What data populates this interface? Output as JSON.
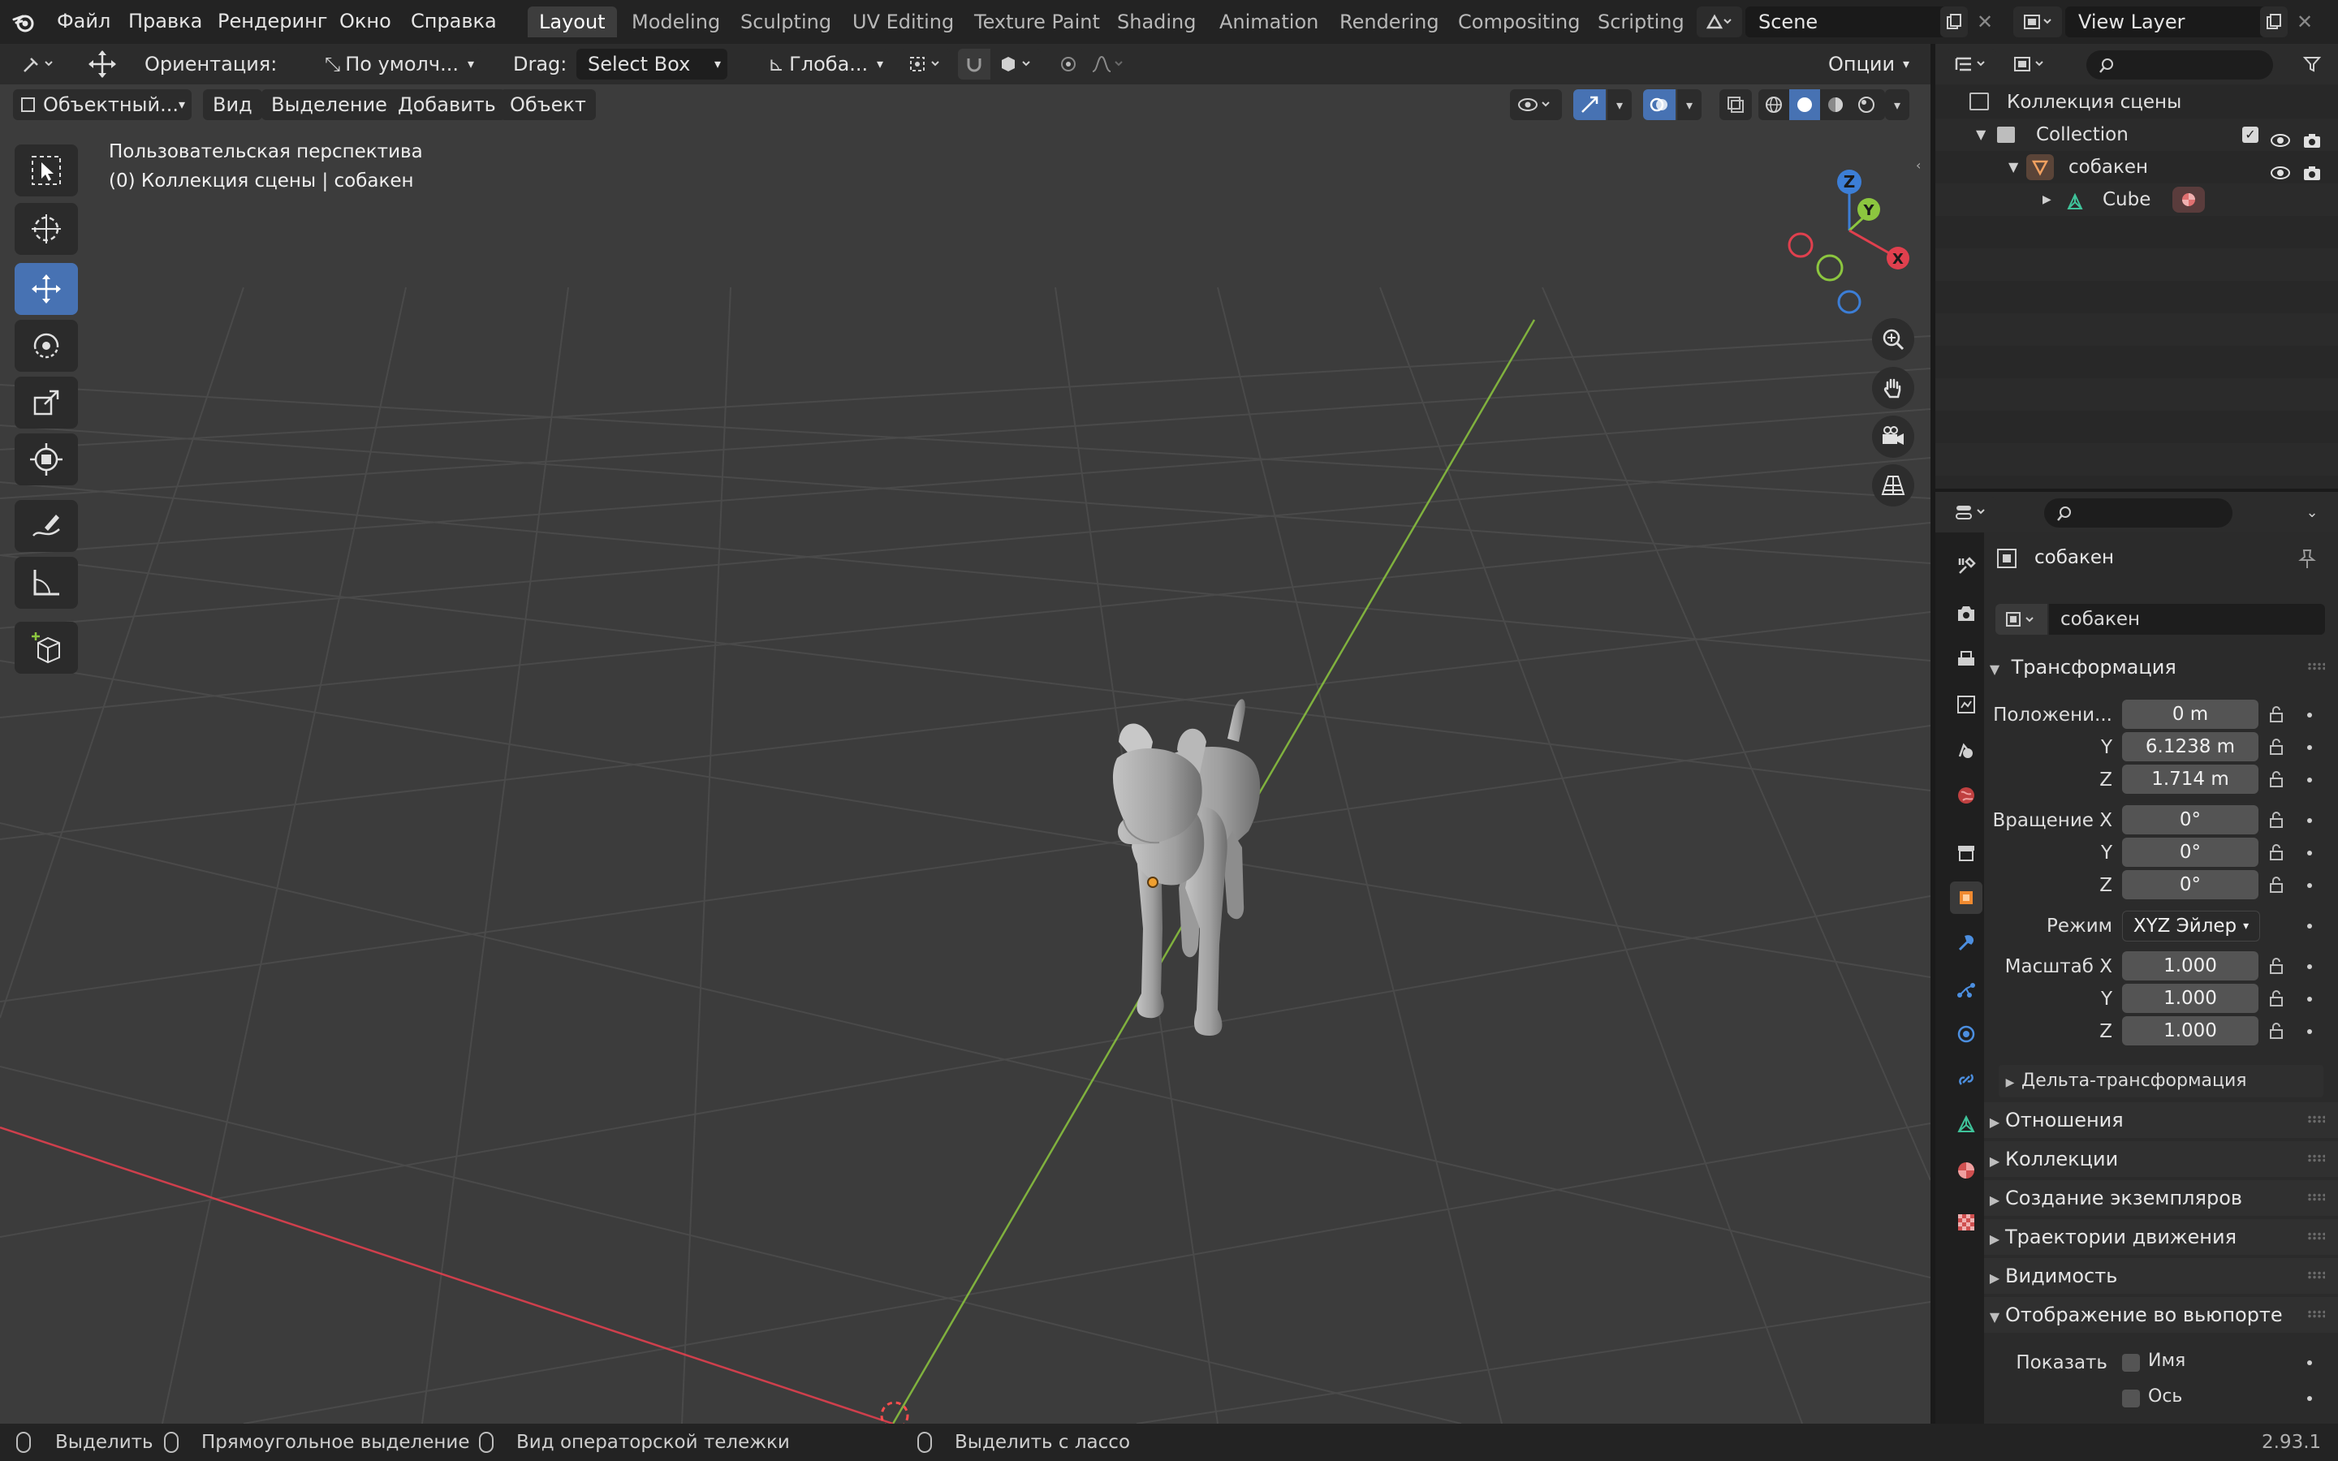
{
  "topbar": {
    "menus": [
      "Файл",
      "Правка",
      "Рендеринг",
      "Окно",
      "Справка"
    ],
    "workspaces": [
      "Layout",
      "Modeling",
      "Sculpting",
      "UV Editing",
      "Texture Paint",
      "Shading",
      "Animation",
      "Rendering",
      "Compositing",
      "Scripting"
    ],
    "active_workspace": "Layout",
    "scene": "Scene",
    "view_layer": "View Layer"
  },
  "tool_header": {
    "orientation_label": "Ориентация:",
    "orientation_value": "По умолч...",
    "drag_label": "Drag:",
    "drag_value": "Select Box",
    "transform_orientation": "Глоба...",
    "options": "Опции"
  },
  "viewport_header": {
    "mode": "Объектный...",
    "menus": [
      "Вид",
      "Выделение",
      "Добавить",
      "Объект"
    ]
  },
  "viewport": {
    "view_name": "Пользовательская перспектива",
    "collection_info": "(0) Коллекция сцены | собакен",
    "gizmo": {
      "z": "Z",
      "y": "Y",
      "x": "X"
    }
  },
  "outliner": {
    "search_placeholder": "",
    "root": "Коллекция сцены",
    "collection": "Collection",
    "object": "собакен",
    "mesh": "Cube"
  },
  "properties": {
    "object_name": "собакен",
    "object_name_field": "собакен",
    "transform_title": "Трансформация",
    "location_label": "Положени...",
    "location": {
      "x": "0 m",
      "y": "6.1238 m",
      "z": "1.714 m"
    },
    "rotation_label": "Вращение X",
    "rotation": {
      "x": "0°",
      "y": "0°",
      "z": "0°"
    },
    "mode_label": "Режим",
    "mode_value": "XYZ Эйлер",
    "scale_label": "Масштаб X",
    "scale": {
      "x": "1.000",
      "y": "1.000",
      "z": "1.000"
    },
    "axis_y": "Y",
    "axis_z": "Z",
    "delta": "Дельта-трансформация",
    "panels": [
      "Отношения",
      "Коллекции",
      "Создание экземпляров",
      "Траектории движения",
      "Видимость"
    ],
    "viewport_display": "Отображение во вьюпорте",
    "show_label": "Показать",
    "show_name": "Имя",
    "show_axis": "Ось"
  },
  "statusbar": {
    "select": "Выделить",
    "box_select": "Прямоугольное выделение",
    "dolly": "Вид операторской тележки",
    "lasso": "Выделить с лассо",
    "version": "2.93.1"
  },
  "colors": {
    "accent": "#4772b3",
    "x_axis": "#e0404e",
    "y_axis": "#8cc63f",
    "z_axis": "#3c7ed6"
  }
}
